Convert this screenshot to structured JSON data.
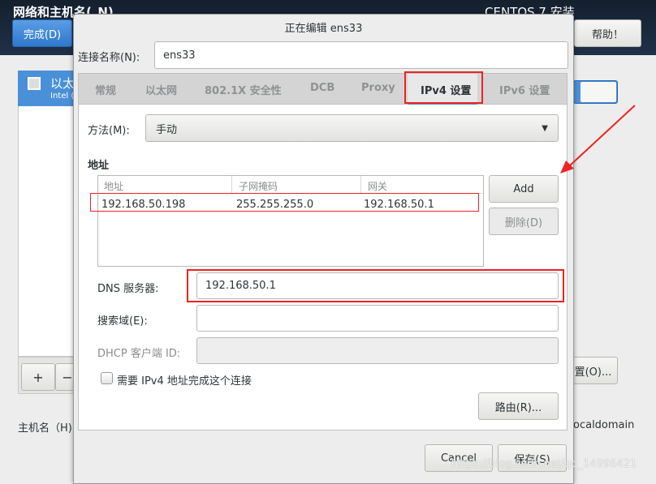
{
  "header": {
    "title": "网络和主机名(_N)",
    "installer": "CENTOS 7 安装",
    "done": "完成(D)",
    "help": "帮助！"
  },
  "background": {
    "connection_name": "以太",
    "connection_sub": "Intel (",
    "add": "+",
    "remove": "−",
    "configure": "置(O)...",
    "hostname_label": "主机名（H)",
    "hostname_value": "ocaldomain"
  },
  "dialog": {
    "title": "正在编辑 ens33",
    "conn_name_label": "连接名称(N):",
    "conn_name_value": "ens33",
    "tabs": [
      {
        "label": "常规"
      },
      {
        "label": "以太网"
      },
      {
        "label": "802.1X 安全性"
      },
      {
        "label": "DCB"
      },
      {
        "label": "Proxy"
      },
      {
        "label": "IPv4 设置",
        "active": true
      },
      {
        "label": "IPv6 设置"
      }
    ],
    "method_label": "方法(M):",
    "method_value": "手动",
    "address_heading": "地址",
    "table": {
      "headers": [
        "地址",
        "子网掩码",
        "网关"
      ],
      "rows": [
        [
          "192.168.50.198",
          "255.255.255.0",
          "192.168.50.1"
        ]
      ]
    },
    "add": "Add",
    "delete": "删除(D)",
    "dns_label": "DNS 服务器:",
    "dns_value": "192.168.50.1",
    "search_label": "搜索域(E):",
    "search_value": "",
    "dhcp_label": "DHCP 客户端 ID:",
    "dhcp_value": "",
    "require_ipv4": "需要 IPv4 地址完成这个连接",
    "require_ipv4_checked": false,
    "routes": "路由(R)...",
    "cancel": "Cancel",
    "save": "保存(S)"
  },
  "watermark": "https://blog.csdn.net/qq_14996421",
  "colors": {
    "accent": "#4a90d9",
    "annotation": "#ee2222",
    "header": "#1b2a3c"
  }
}
